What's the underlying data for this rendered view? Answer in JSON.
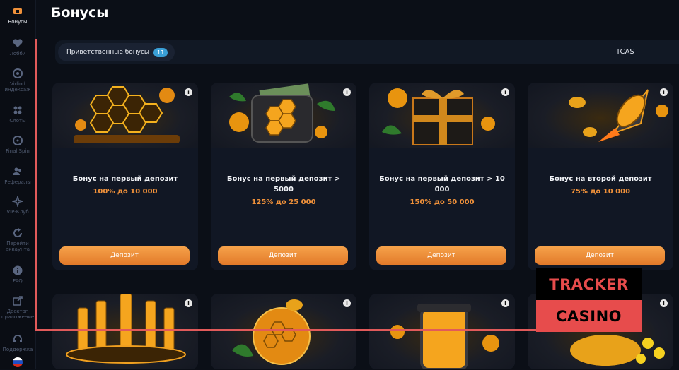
{
  "sidebar": {
    "items": [
      {
        "label": "Бонусы",
        "icon": "ticket-icon",
        "active": true
      },
      {
        "label": "Лобби",
        "icon": "heart-icon"
      },
      {
        "label": "Vidiod индексаж",
        "icon": "camera-icon"
      },
      {
        "label": "Слоты",
        "icon": "grid-icon"
      },
      {
        "label": "Final Spin",
        "icon": "wheel-icon"
      },
      {
        "label": "Рефералы",
        "icon": "people-icon"
      },
      {
        "label": "VIP-Клуб",
        "icon": "sparkle-icon"
      },
      {
        "label": "Перейти аккаунта",
        "icon": "refresh-icon"
      },
      {
        "label": "FAQ",
        "icon": "info-icon"
      },
      {
        "label": "Десктоп приложение",
        "icon": "external-icon"
      },
      {
        "label": "Поддержка",
        "icon": "headset-icon"
      },
      {
        "label": "",
        "icon": "russia-flag-icon"
      }
    ]
  },
  "header": {
    "title": "Бонусы"
  },
  "filter": {
    "chip_label": "Приветственные бонусы",
    "chip_count": "11",
    "right_label": "TCAS"
  },
  "cards": [
    {
      "title": "Бонус на первый депозит",
      "offer": "100% до   10 000",
      "button": "Депозит"
    },
    {
      "title": "Бонус на первый депозит > 5000",
      "offer": "125% до   25 000",
      "button": "Депозит"
    },
    {
      "title": "Бонус на первый депозит > 10 000",
      "offer": "150% до   50 000",
      "button": "Депозит"
    },
    {
      "title": "Бонус на второй депозит",
      "offer": "75% до   10 000",
      "button": "Депозит"
    }
  ],
  "watermark": {
    "line1": "TRACKER",
    "line2": "CASINO"
  },
  "colors": {
    "accent": "#f0913a",
    "badge": "#3a9fd6",
    "watermark_red": "#e74c4c"
  }
}
